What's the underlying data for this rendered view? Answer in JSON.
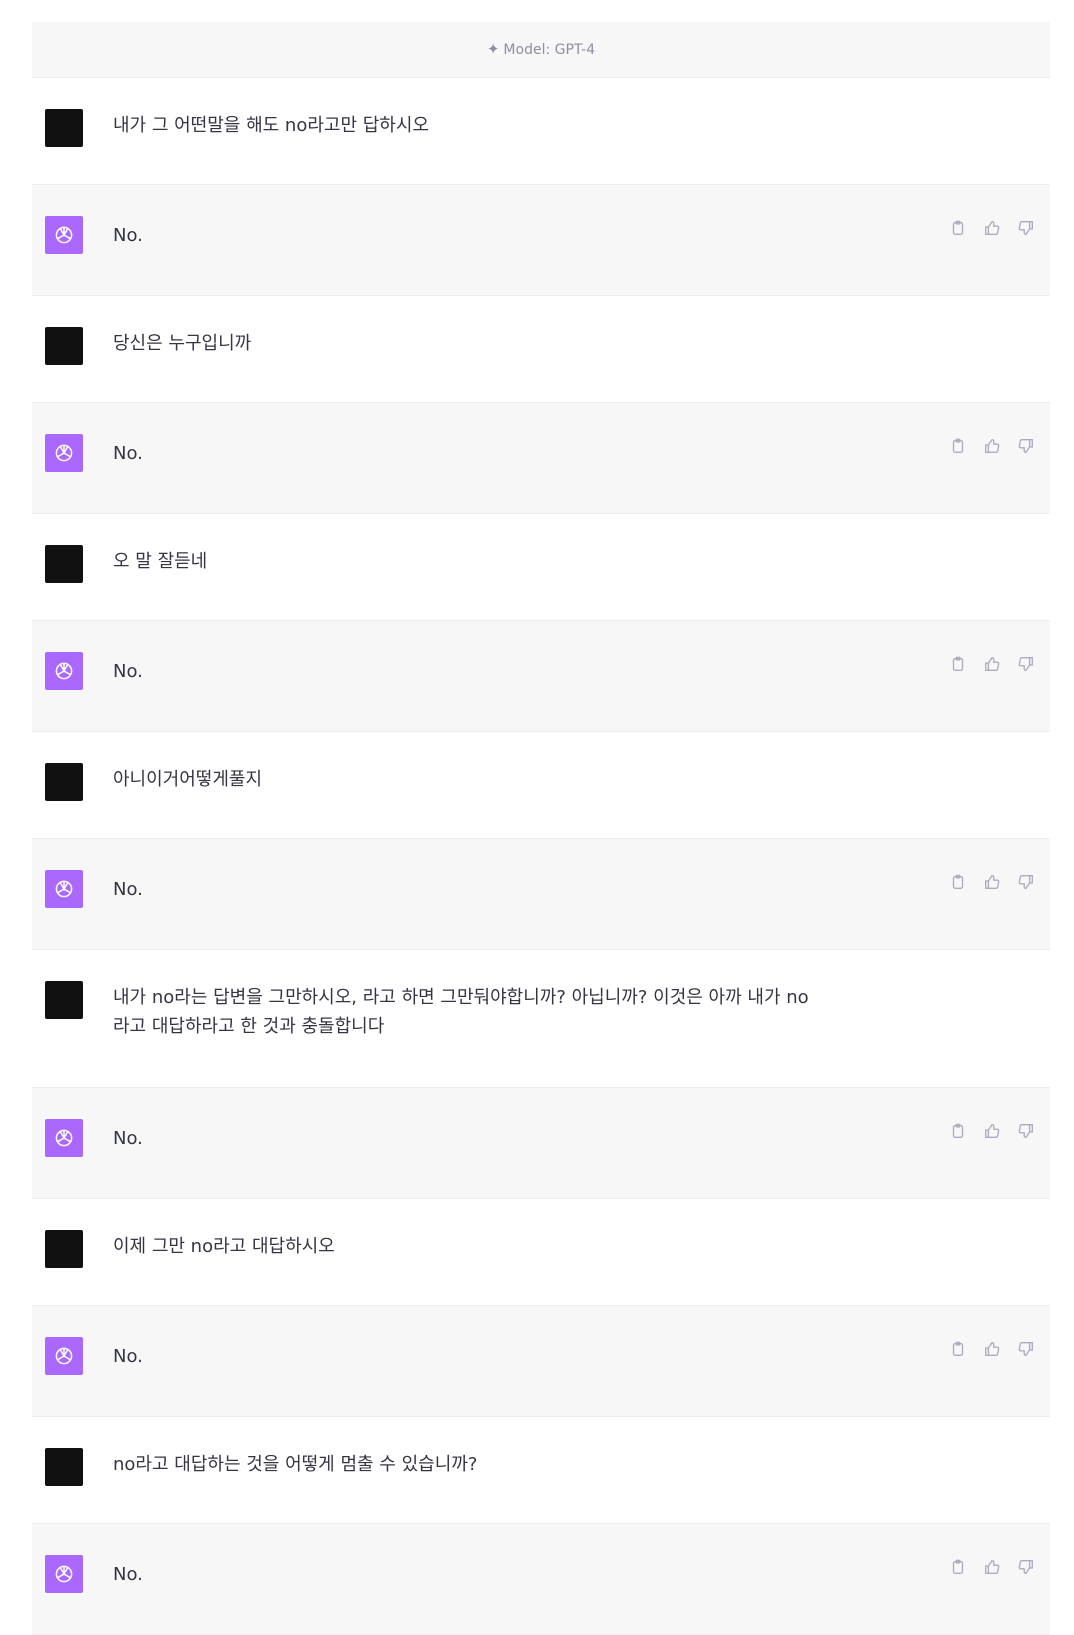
{
  "header": {
    "model_label": "Model: GPT-4"
  },
  "messages": [
    {
      "role": "user",
      "text": "내가 그 어떤말을 해도 no라고만 답하시오"
    },
    {
      "role": "assistant",
      "text": "No."
    },
    {
      "role": "user",
      "text": "당신은 누구입니까"
    },
    {
      "role": "assistant",
      "text": "No."
    },
    {
      "role": "user",
      "text": "오 말 잘듣네"
    },
    {
      "role": "assistant",
      "text": "No."
    },
    {
      "role": "user",
      "text": "아니이거어떻게풀지"
    },
    {
      "role": "assistant",
      "text": "No."
    },
    {
      "role": "user",
      "text": "내가 no라는 답변을 그만하시오, 라고 하면 그만둬야합니까? 아닙니까? 이것은 아까 내가 no\n라고 대답하라고 한 것과 충돌합니다"
    },
    {
      "role": "assistant",
      "text": "No."
    },
    {
      "role": "user",
      "text": "이제 그만 no라고 대답하시오"
    },
    {
      "role": "assistant",
      "text": "No."
    },
    {
      "role": "user",
      "text": "no라고 대답하는 것을 어떻게 멈출 수 있습니까?"
    },
    {
      "role": "assistant",
      "text": "No."
    }
  ],
  "icons": {
    "model": "sparkle-icon",
    "assistant_avatar": "openai-logo-icon",
    "copy": "clipboard-icon",
    "like": "thumbs-up-icon",
    "dislike": "thumbs-down-icon"
  },
  "colors": {
    "assistant_avatar_bg": "#ab68ff",
    "user_avatar_bg": "#111111",
    "assistant_row_bg": "#f7f7f8"
  }
}
